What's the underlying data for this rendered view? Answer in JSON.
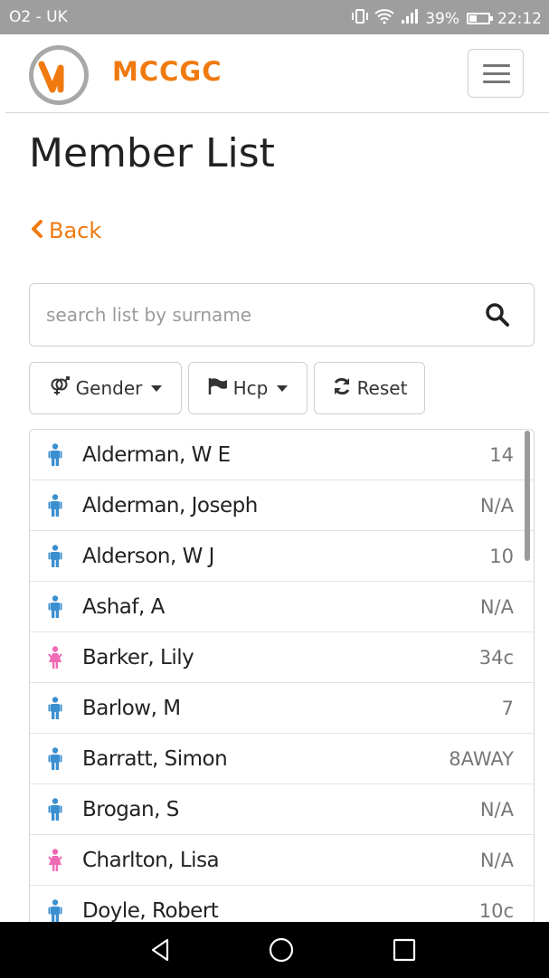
{
  "status_bar": {
    "carrier": "O2 - UK",
    "battery": "39%",
    "time": "22:12"
  },
  "navbar": {
    "brand": "MCCGC"
  },
  "page": {
    "title": "Member List",
    "back_label": "Back"
  },
  "search": {
    "placeholder": "search list by surname",
    "value": ""
  },
  "filters": {
    "gender_label": "Gender",
    "hcp_label": "Hcp",
    "reset_label": "Reset"
  },
  "colors": {
    "accent": "#f07a10",
    "male": "#3a8fd0",
    "female": "#f06bb5"
  },
  "members": [
    {
      "name": "Alderman, W E",
      "hcp": "14",
      "gender": "male"
    },
    {
      "name": "Alderman, Joseph",
      "hcp": "N/A",
      "gender": "male"
    },
    {
      "name": "Alderson, W J",
      "hcp": "10",
      "gender": "male"
    },
    {
      "name": "Ashaf, A",
      "hcp": "N/A",
      "gender": "male"
    },
    {
      "name": "Barker, Lily",
      "hcp": "34c",
      "gender": "female"
    },
    {
      "name": "Barlow, M",
      "hcp": "7",
      "gender": "male"
    },
    {
      "name": "Barratt, Simon",
      "hcp": "8AWAY",
      "gender": "male"
    },
    {
      "name": "Brogan, S",
      "hcp": "N/A",
      "gender": "male"
    },
    {
      "name": "Charlton, Lisa",
      "hcp": "N/A",
      "gender": "female"
    },
    {
      "name": "Doyle, Robert",
      "hcp": "10c",
      "gender": "male"
    }
  ]
}
